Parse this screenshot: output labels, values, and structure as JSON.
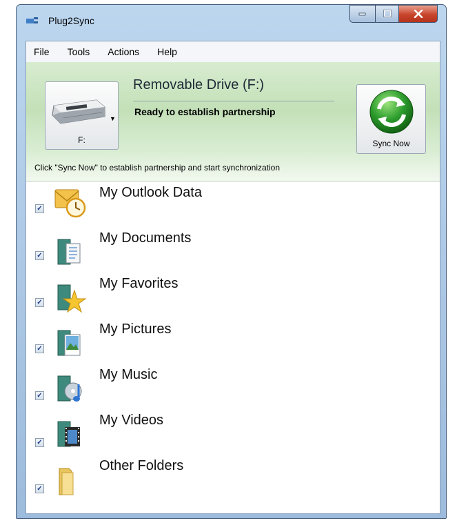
{
  "window": {
    "title": "Plug2Sync"
  },
  "menu": [
    "File",
    "Tools",
    "Actions",
    "Help"
  ],
  "drive": {
    "letter": "F:",
    "name": "Removable Drive (F:)",
    "status": "Ready to establish partnership"
  },
  "sync_button": {
    "label": "Sync Now"
  },
  "hint": "Click \"Sync Now\" to establish partnership and start synchronization",
  "folders": [
    {
      "label": "My Outlook Data",
      "checked": true,
      "icon": "outlook-icon"
    },
    {
      "label": "My Documents",
      "checked": true,
      "icon": "documents-library-icon"
    },
    {
      "label": "My Favorites",
      "checked": true,
      "icon": "favorites-icon"
    },
    {
      "label": "My Pictures",
      "checked": true,
      "icon": "pictures-library-icon"
    },
    {
      "label": "My Music",
      "checked": true,
      "icon": "music-library-icon"
    },
    {
      "label": "My Videos",
      "checked": true,
      "icon": "videos-library-icon"
    },
    {
      "label": "Other Folders",
      "checked": true,
      "icon": "folder-icon"
    }
  ],
  "colors": {
    "sync_green": "#2e9e2e",
    "header_green": "#c3e0b8",
    "close_red": "#c8442b"
  }
}
